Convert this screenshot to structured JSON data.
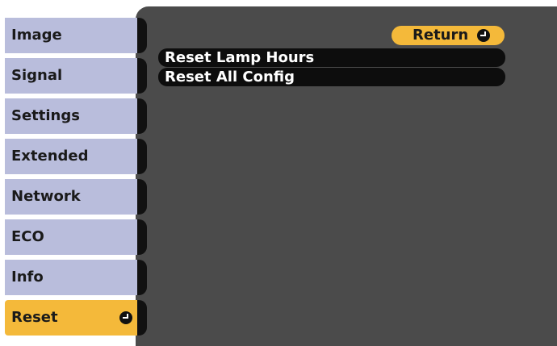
{
  "sidebar": {
    "items": [
      {
        "label": "Image"
      },
      {
        "label": "Signal"
      },
      {
        "label": "Settings"
      },
      {
        "label": "Extended"
      },
      {
        "label": "Network"
      },
      {
        "label": "ECO"
      },
      {
        "label": "Info"
      },
      {
        "label": "Reset",
        "selected": true,
        "icon": "enter-icon"
      }
    ]
  },
  "submenu": {
    "return_label": "Return",
    "return_icon": "enter-icon",
    "options": [
      {
        "label": "Reset Lamp Hours"
      },
      {
        "label": "Reset All Config"
      }
    ]
  },
  "colors": {
    "panel_bg": "#4b4b4b",
    "menu_item_bg": "#b9bddc",
    "active_bg": "#f4b93a",
    "option_row_bg": "#0d0d0d"
  }
}
